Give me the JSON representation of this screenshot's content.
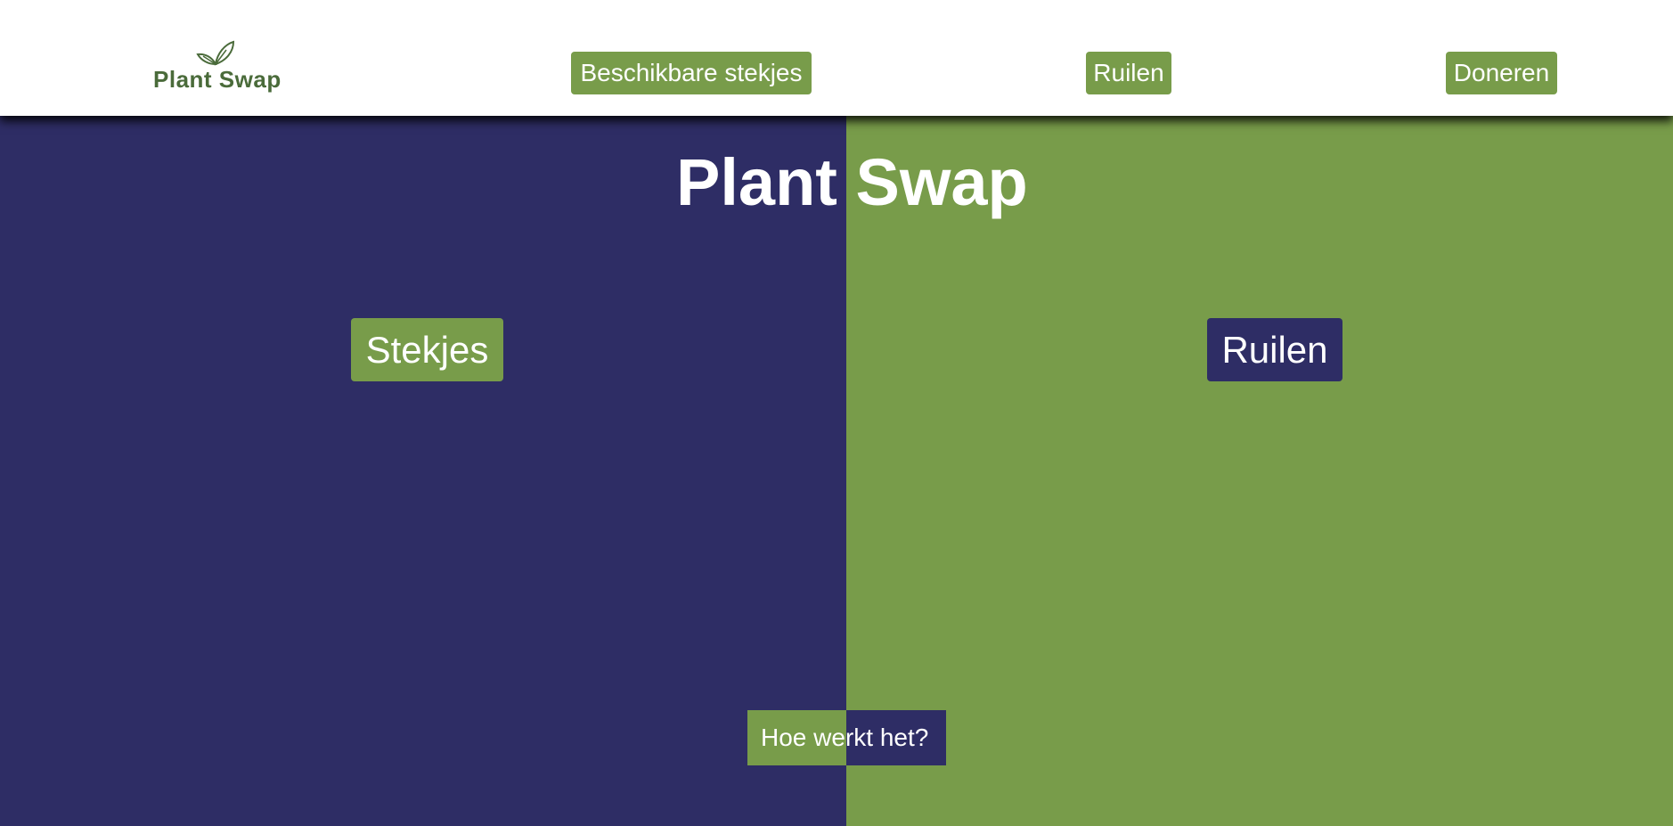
{
  "header": {
    "logo_text": "Plant Swap",
    "nav": [
      {
        "label": "Beschikbare stekjes"
      },
      {
        "label": "Ruilen"
      },
      {
        "label": "Doneren"
      }
    ]
  },
  "hero": {
    "title": "Plant Swap",
    "left_button": "Stekjes",
    "right_button": "Ruilen",
    "how_button": "Hoe werkt het?"
  },
  "colors": {
    "navy": "#2e2d65",
    "green": "#789c4a",
    "logo_green": "#4a6b3a",
    "white": "#ffffff"
  }
}
